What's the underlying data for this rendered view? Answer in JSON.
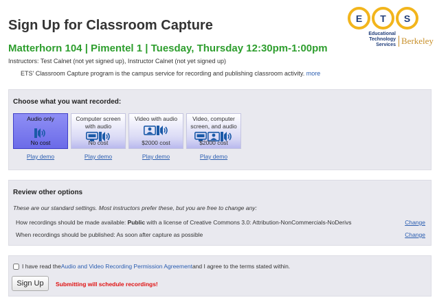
{
  "page": {
    "title": "Sign Up for Classroom Capture",
    "course_line": "Matterhorn 104 | Pimentel 1 | Tuesday, Thursday 12:30pm-1:00pm",
    "instructors": "Instructors: Test Calnet (not yet signed up), Instructor Calnet (not yet signed up)",
    "intro": "ETS' Classroom Capture program is the campus service for recording and publishing classroom activity.",
    "intro_more": "more"
  },
  "logo": {
    "letters": [
      "E",
      "T",
      "S"
    ],
    "subtitle_lines": [
      "Educational",
      "Technology",
      "Services"
    ],
    "berkeley": "Berkeley"
  },
  "recording": {
    "heading": "Choose what you want recorded:",
    "options": [
      {
        "label": "Audio only",
        "cost": "No cost",
        "demo": "Play demo",
        "selected": true,
        "icons": [
          "speaker-icon"
        ]
      },
      {
        "label": "Computer screen with audio",
        "cost": "No cost",
        "demo": "Play demo",
        "selected": false,
        "icons": [
          "screen-icon",
          "speaker-icon"
        ]
      },
      {
        "label": "Video with audio",
        "cost": "$2000 cost",
        "demo": "Play demo",
        "selected": false,
        "icons": [
          "camera-person-icon",
          "speaker-icon"
        ]
      },
      {
        "label": "Video, computer screen, and audio",
        "cost": "$2000 cost",
        "demo": "Play demo",
        "selected": false,
        "icons": [
          "screen-icon",
          "camera-person-icon",
          "speaker-icon"
        ]
      }
    ]
  },
  "review": {
    "heading": "Review other options",
    "note": "These are our standard settings. Most instructors prefer these, but you are free to change any:",
    "availability_prefix": "How recordings should be made available: ",
    "availability_value": "Public",
    "availability_suffix": " with a license of Creative Commons 3.0: Attribution-NonCommercials-NoDerivs",
    "publish_prefix": "When recordings should be published: ",
    "publish_value": "As soon after capture as possible",
    "change_label": "Change"
  },
  "agreement": {
    "prefix": "I have read the ",
    "link": "Audio and Video Recording Permission Agreement",
    "suffix": " and I agree to the terms stated within.",
    "checked": false
  },
  "submit": {
    "button": "Sign Up",
    "warning": "Submitting will schedule recordings!"
  },
  "colors": {
    "accent_green": "#2e9e2e",
    "link_blue": "#2a5db0",
    "selected_option": "#6b6be8",
    "warning_red": "#e01010",
    "logo_gold": "#f2b51c"
  }
}
